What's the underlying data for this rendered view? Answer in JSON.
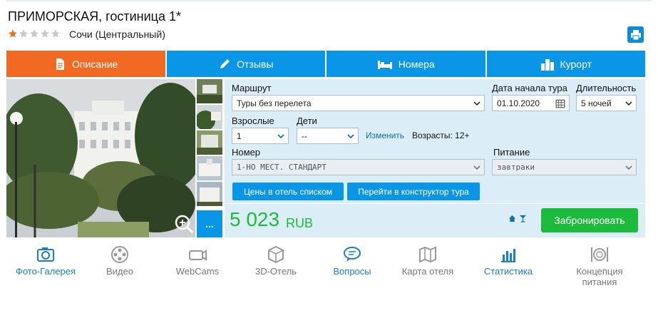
{
  "hotel": {
    "title": "ПРИМОРСКАЯ, гостиница 1*",
    "stars_filled": 1,
    "stars_total": 5,
    "location": "Сочи (Центральный)"
  },
  "tabs": [
    {
      "label": "Описание",
      "icon": "document-icon",
      "active": true
    },
    {
      "label": "Отзывы",
      "icon": "pencil-icon",
      "active": false
    },
    {
      "label": "Номера",
      "icon": "bed-icon",
      "active": false
    },
    {
      "label": "Курорт",
      "icon": "city-icon",
      "active": false
    }
  ],
  "gallery": {
    "more_label": "...",
    "thumbnail_count": 5
  },
  "form": {
    "route_label": "Маршрут",
    "route_value": "Туры без перелета",
    "date_label": "Дата начала тура",
    "date_value": "01.10.2020",
    "duration_label": "Длительность",
    "duration_value": "5 ночей",
    "adults_label": "Взрослые",
    "adults_value": "1",
    "children_label": "Дети",
    "children_value": "--",
    "change_link": "Изменить",
    "ages_text": "Возрасты: 12+",
    "room_label": "Номер",
    "room_value": "1-НО МЕСТ. СТАНДАРТ",
    "meal_label": "Питание",
    "meal_value": "завтраки",
    "prices_button": "Цены в отель списком",
    "constructor_button": "Перейти в конструктор тура"
  },
  "price": {
    "amount": "5 023",
    "currency": "RUB",
    "book_button": "Забронировать"
  },
  "features": [
    {
      "label": "Фото-Галерея",
      "icon": "camera-icon",
      "active": true
    },
    {
      "label": "Видео",
      "icon": "film-reel-icon",
      "active": false
    },
    {
      "label": "WebCams",
      "icon": "webcam-icon",
      "active": false
    },
    {
      "label": "3D-Отель",
      "icon": "3d-cube-icon",
      "active": false
    },
    {
      "label": "Вопросы",
      "icon": "chat-bubble-icon",
      "active": true
    },
    {
      "label": "Карта отеля",
      "icon": "map-icon",
      "active": false
    },
    {
      "label": "Статистика",
      "icon": "bar-chart-icon",
      "active": true
    },
    {
      "label": "Концепция питания",
      "icon": "plate-icon",
      "active": false
    }
  ],
  "colors": {
    "accent_blue": "#0a96e6",
    "active_orange": "#f26a21",
    "price_green": "#1dbb3c",
    "panel_bg": "#dbedf7"
  }
}
